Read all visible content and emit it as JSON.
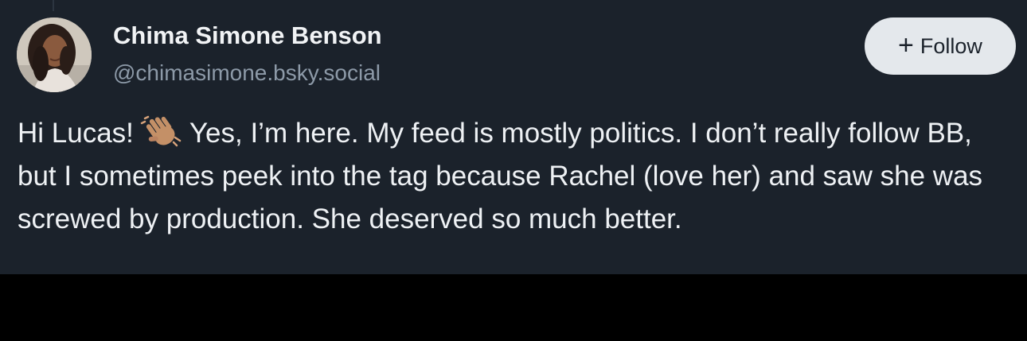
{
  "author": {
    "display_name": "Chima Simone Benson",
    "handle": "@chimasimone.bsky.social"
  },
  "follow_button": {
    "icon": "plus-icon",
    "label": "Follow"
  },
  "post": {
    "text_before_emoji": "Hi Lucas!",
    "emoji": "waving-hand-emoji",
    "text_after_emoji": "Yes, I’m here. My feed is mostly politics. I don’t really follow BB, but I sometimes peek into the tag because Rachel (love her) and saw she was screwed by production. She deserved so much better."
  },
  "colors": {
    "background": "#1b222b",
    "letterbox": "#000000",
    "text_primary": "#f1f3f5",
    "text_secondary": "#8d9aa8",
    "button_bg": "#e4e8ec"
  }
}
